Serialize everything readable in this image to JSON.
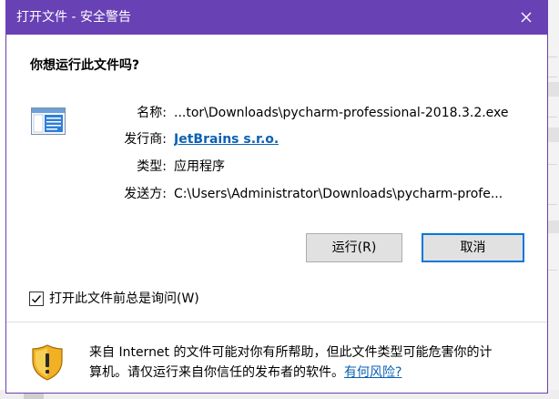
{
  "window": {
    "title": "打开文件 - 安全警告",
    "titlebar_color": "#6841b5",
    "close_icon": "close-icon"
  },
  "question": "你想运行此文件吗?",
  "details": [
    {
      "label": "名称:",
      "value": "...tor\\Downloads\\pycharm-professional-2018.3.2.exe",
      "link": false
    },
    {
      "label": "发行商:",
      "value": "JetBrains s.r.o.",
      "link": true
    },
    {
      "label": "类型:",
      "value": "应用程序",
      "link": false
    },
    {
      "label": "发送方:",
      "value": "C:\\Users\\Administrator\\Downloads\\pycharm-profe...",
      "link": false
    }
  ],
  "buttons": {
    "run": "运行(R)",
    "cancel": "取消"
  },
  "checkbox": {
    "label": "打开此文件前总是询问(W)",
    "checked": true
  },
  "warning": {
    "line1": "来自 Internet 的文件可能对你有所帮助，但此文件类型可能危害你的计",
    "line2": "算机。请仅运行来自你信任的发布者的软件。",
    "link": "有何风险?",
    "link_color": "#0b61b3"
  },
  "icons": {
    "app": "application-window-icon",
    "shield": "security-shield-icon",
    "check": "checkmark-icon"
  }
}
